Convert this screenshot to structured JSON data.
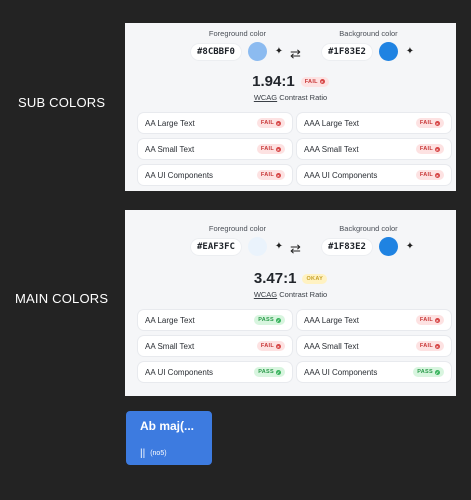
{
  "labels": {
    "sub": "SUB COLORS",
    "main": "MAIN COLORS"
  },
  "common": {
    "fg_label": "Foreground color",
    "bg_label": "Background color",
    "cr_link": "WCAG",
    "cr_suffix": "Contrast Ratio"
  },
  "sub": {
    "fg_hex": "#8CBBF0",
    "bg_hex": "#1F83E2",
    "fg_color": "#8CBBF0",
    "bg_color": "#1F83E2",
    "ratio": "1.94:1",
    "ratio_badge": "FAIL",
    "checks": [
      {
        "label": "AA Large Text",
        "status": "FAIL"
      },
      {
        "label": "AAA Large Text",
        "status": "FAIL"
      },
      {
        "label": "AA Small Text",
        "status": "FAIL"
      },
      {
        "label": "AAA Small Text",
        "status": "FAIL"
      },
      {
        "label": "AA UI Components",
        "status": "FAIL"
      },
      {
        "label": "AAA UI Components",
        "status": "FAIL"
      }
    ]
  },
  "main": {
    "fg_hex": "#EAF3FC",
    "bg_hex": "#1F83E2",
    "fg_color": "#EAF3FC",
    "bg_color": "#1F83E2",
    "ratio": "3.47:1",
    "ratio_badge": "OKAY",
    "checks": [
      {
        "label": "AA Large Text",
        "status": "PASS"
      },
      {
        "label": "AAA Large Text",
        "status": "FAIL"
      },
      {
        "label": "AA Small Text",
        "status": "FAIL"
      },
      {
        "label": "AAA Small Text",
        "status": "FAIL"
      },
      {
        "label": "AA UI Components",
        "status": "PASS"
      },
      {
        "label": "AAA UI Components",
        "status": "PASS"
      }
    ]
  },
  "preview": {
    "title": "Ab maj(...",
    "bars": "||",
    "note": "(no5)"
  }
}
